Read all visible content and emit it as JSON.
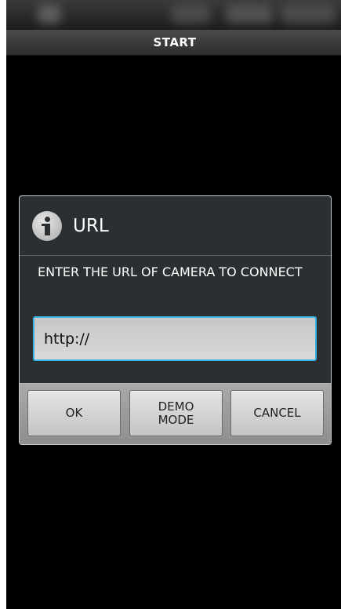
{
  "title_bar": {
    "title": "START"
  },
  "dialog": {
    "icon": "info-icon",
    "title": "URL",
    "message": "ENTER THE URL OF CAMERA TO CONNECT",
    "url_input": {
      "value": "http://",
      "placeholder": ""
    },
    "buttons": {
      "ok": "OK",
      "demo": "DEMO\nMODE",
      "cancel": "CANCEL"
    }
  },
  "colors": {
    "background": "#000000",
    "dialog_bg": "#2b2f31",
    "input_focus_border": "#3ab5e8",
    "button_bar": "#9e9e9e"
  }
}
